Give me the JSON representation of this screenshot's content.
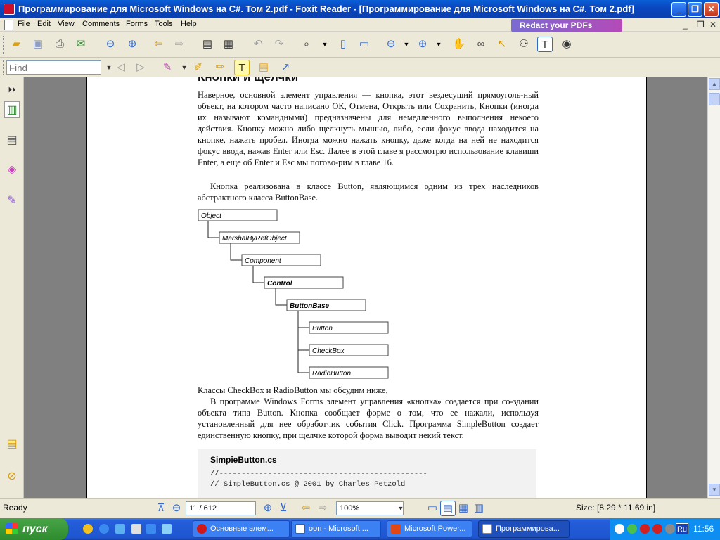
{
  "window": {
    "title": "Программирование для Microsoft Windows на C#. Том 2.pdf - Foxit Reader - [Программирование для Microsoft Windows на C#. Том 2.pdf]"
  },
  "menu": [
    "File",
    "Edit",
    "View",
    "Comments",
    "Forms",
    "Tools",
    "Help"
  ],
  "banner": "Redact your PDFs",
  "search": {
    "placeholder": "Find"
  },
  "doc": {
    "heading": "Кнопки и щелчки",
    "p1": "Наверное, основной элемент управления — кнопка, этот вездесущий прямоуголь-ный объект, на котором часто написано ОК, Отмена, Открыть или Сохранить, Кнопки (иногда их называют командными) предназначены для немедленного выполнения некоего действия. Кнопку можно либо щелкнуть мышью, либо, если фокус ввода находится на кнопке, нажать пробел. Иногда можно нажать кнопку, даже когда на ней не находится фокус ввода, нажав Enter или Esc. Далее в этой главе я рассмотрю использование клавиши Enter, а еще об Enter и Esc мы погово-рим в главе 16.",
    "p2": "Кнопка реализована в классе Button, являющимся одним из трех наследников абстрактного класса ButtonBase.",
    "tree": [
      "Object",
      "MarshalByRefObject",
      "Component",
      "Control",
      "ButtonBase",
      "Button",
      "CheckBox",
      "RadioButton"
    ],
    "p3": "Классы CheckBox и RadioButton мы обсудим ниже,",
    "p4": "В программе Windows Forms элемент управления «кнопка» создается при со-здании объекта типа Button. Кнопка сообщает форме о том, что ее нажали, используя установленный для нее обработчик события Click. Программа SimpleButton создает единственную кнопку, при щелчке которой форма выводит некий текст.",
    "code_title": "SimpieButton.cs",
    "code_lines": [
      "//-----------------------------------------------",
      "// SimpleButton.cs @ 2001 by Charles Petzold"
    ]
  },
  "status": {
    "ready": "Ready",
    "page": "11 / 612",
    "zoom": "100%",
    "size": "Size: [8.29 * 11.69 in]"
  },
  "taskbar": {
    "start": "пуск",
    "tasks": [
      "Основные элем...",
      "oon - Microsoft ...",
      "Microsoft Power...",
      "Программирова..."
    ],
    "tray_lang": "Ru",
    "clock": "11:56"
  }
}
